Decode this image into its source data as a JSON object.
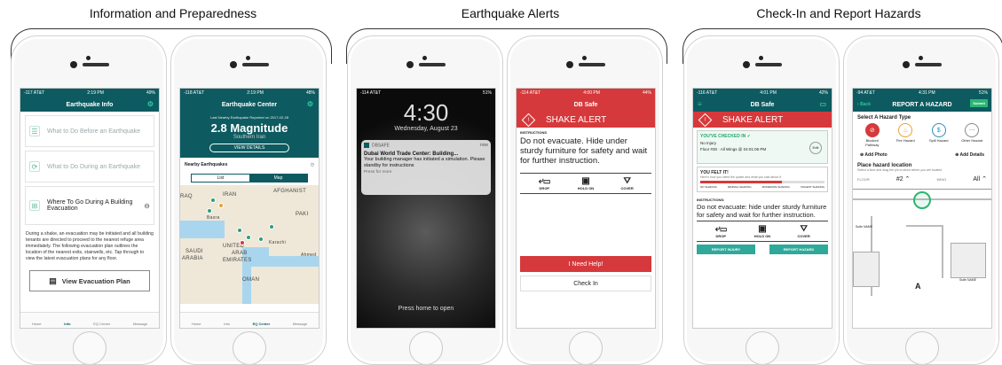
{
  "sections": [
    {
      "title": "Information and Preparedness"
    },
    {
      "title": "Earthquake Alerts"
    },
    {
      "title": "Check-In and Report Hazards"
    }
  ],
  "colors": {
    "teal": "#0d5b60",
    "red": "#d6393b",
    "mint": "#2ea99a",
    "green": "#2bb673"
  },
  "phone1": {
    "status_left": "-117 AT&T",
    "status_time": "2:19 PM",
    "status_right": "49%",
    "nav_title": "Earthquake Info",
    "items": [
      {
        "label": "What to Do Before an Earthquake",
        "icon": "list-icon"
      },
      {
        "label": "What to Do During an Earthquake",
        "icon": "refresh-icon"
      },
      {
        "label": "Where To Go During A Building Evacuation",
        "icon": "door-icon"
      }
    ],
    "body": "During a shake, an evacuation may be initiated and all building tenants are directed to proceed to the nearest refuge area immediately. The following evacuation plan outlines the location of the nearest exits, stairwells, etc. Tap through to view the latest evacuation plans for any floor.",
    "evac_button": "View Evacuation Plan",
    "tabs": [
      "Home",
      "Info",
      "EQ Center",
      "Message"
    ],
    "selected_tab": "Info"
  },
  "phone2": {
    "status_left": "-118 AT&T",
    "status_time": "2:19 PM",
    "status_right": "48%",
    "nav_title": "Earthquake Center",
    "last_reported": "Last Nearby Earthquake Reported on 2017-02-28",
    "magnitude": "2.8 Magnitude",
    "location": "Southern Iran",
    "view_details": "VIEW DETAILS",
    "nearby": "Nearby Earthquakes",
    "segments": [
      "List",
      "Map"
    ],
    "map_labels": [
      "IRAN",
      "AFGHANIST",
      "RAQ",
      "PAKI",
      "Basra",
      "SAUDI",
      "ARABIA",
      "UNITED",
      "ARAB",
      "EMIRATES",
      "Karachi",
      "Ahmed",
      "OMAN"
    ],
    "tabs": [
      "Home",
      "Info",
      "EQ Center",
      "Message"
    ],
    "selected_tab": "EQ Center"
  },
  "phone3": {
    "status_left": "-114 AT&T",
    "status_right": "51%",
    "time": "4:30",
    "date": "Wednesday, August 23",
    "app": "DBSAFE",
    "when": "now",
    "notif_title": "Dubai World Trade Center: Building...",
    "notif_body": "Your building manager has initiated a simulation. Please standby for instructions",
    "notif_more": "Press for more",
    "press_home": "Press home to open"
  },
  "phone4": {
    "status_left": "-114 AT&T",
    "status_time": "4:00 PM",
    "status_right": "44%",
    "nav_title": "DB Safe",
    "alert": "SHAKE ALERT",
    "inst_label": "INSTRUCTIONS",
    "instruction": "Do not evacuate. Hide under sturdy furniture for safety and wait for further instruction.",
    "actions": [
      "DROP",
      "HOLD ON",
      "COVER"
    ],
    "help": "I Need Help!",
    "checkin": "Check In"
  },
  "phone5": {
    "status_left": "-116 AT&T",
    "status_time": "4:01 PM",
    "status_right": "42%",
    "nav_title": "DB Safe",
    "alert": "SHAKE ALERT",
    "checked_in": "YOU'VE CHECKED IN",
    "injury": "No Injury",
    "floor": "Floor #30 · All Wings @ 04:01:06 PM",
    "edit": "Edit",
    "felt": "YOU FELT IT!",
    "felt_sub": "Here's how you rated the quake and what you said about it",
    "scale": [
      "NO SHAKING",
      "MINIMAL SHAKING",
      "MODERATE SHAKING",
      "VIOLENT SHAKING"
    ],
    "felt_level": 0.66,
    "inst_label": "INSTRUCTIONS:",
    "instruction": "Do not evacuate: hide under sturdy furniture for safety and wait for further instruction.",
    "actions": [
      "DROP",
      "HOLD ON",
      "COVER"
    ],
    "buttons": [
      "REPORT INJURY",
      "REPORT HAZARD"
    ]
  },
  "phone6": {
    "status_left": "-94 AT&T",
    "status_time": "4:31 PM",
    "status_right": "51%",
    "back": "Back",
    "nav_title": "REPORT A HAZARD",
    "submit": "Submit",
    "select_type": "Select A Hazard Type",
    "hazards": [
      "Blocked Pathway",
      "Fire Hazard",
      "Spill Hazard",
      "Other Hazard"
    ],
    "add_photo": "Add Photo",
    "add_details": "Add Details",
    "place": "Place hazard location",
    "place_sub": "Select a floor and drag the pin to show where you are located",
    "floor_label": "FLOOR",
    "floor": "#2",
    "wing_label": "WING",
    "wing": "All",
    "plan_labels": [
      "Suite NAME",
      "Suite NAME",
      "A"
    ]
  }
}
